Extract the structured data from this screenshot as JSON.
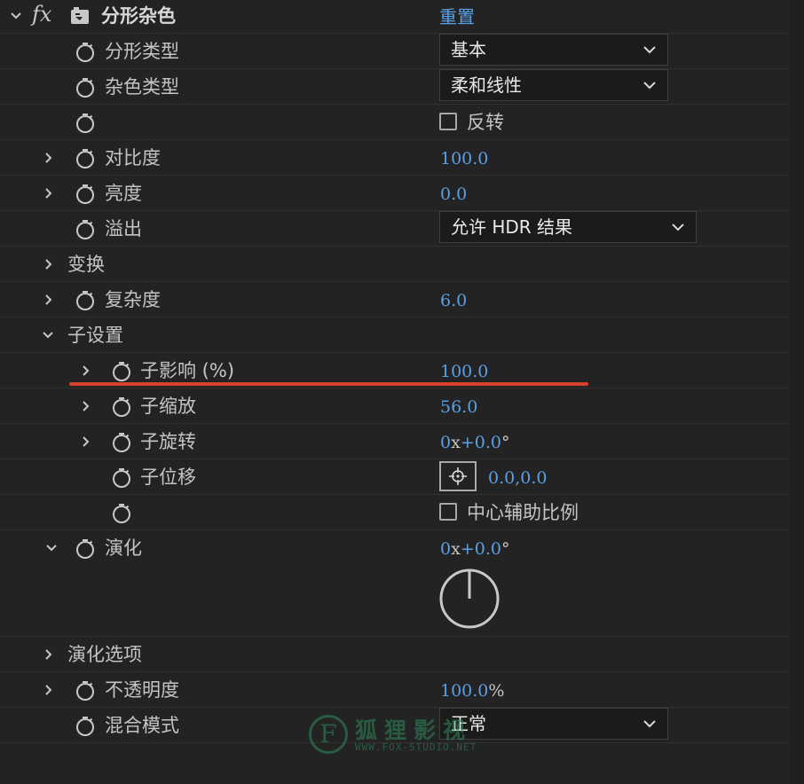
{
  "effect": {
    "name": "分形杂色",
    "reset_label": "重置",
    "fx_label": "fx"
  },
  "rows": {
    "fractal_type": {
      "label": "分形类型",
      "value": "基本"
    },
    "noise_type": {
      "label": "杂色类型",
      "value": "柔和线性"
    },
    "invert": {
      "label": "反转",
      "checked": false
    },
    "contrast": {
      "label": "对比度",
      "value": "100.0"
    },
    "brightness": {
      "label": "亮度",
      "value": "0.0"
    },
    "overflow": {
      "label": "溢出",
      "value": "允许 HDR 结果"
    },
    "transform": {
      "label": "变换"
    },
    "complexity": {
      "label": "复杂度",
      "value": "6.0"
    },
    "sub_settings": {
      "label": "子设置"
    },
    "sub_influence": {
      "label": "子影响 (%)",
      "value": "100.0"
    },
    "sub_scaling": {
      "label": "子缩放",
      "value": "56.0"
    },
    "sub_rotation": {
      "label": "子旋转",
      "revolutions": "0",
      "x_sep": "x",
      "degrees": "+0.0",
      "degree_sign": "°"
    },
    "sub_offset": {
      "label": "子位移",
      "value": "0.0,0.0"
    },
    "center_subscale": {
      "label": "中心辅助比例",
      "checked": false
    },
    "evolution": {
      "label": "演化",
      "revolutions": "0",
      "x_sep": "x",
      "degrees": "+0.0",
      "degree_sign": "°"
    },
    "evolution_options": {
      "label": "演化选项"
    },
    "opacity": {
      "label": "不透明度",
      "value": "100.0",
      "unit": "%"
    },
    "blend_mode": {
      "label": "混合模式",
      "value": "正常"
    }
  },
  "watermark": {
    "letter": "F",
    "text": "狐狸影视",
    "sub": "WWW.FOX-STUDIO.NET"
  },
  "colors": {
    "background": "#232323",
    "value_blue": "#5aa0e6",
    "highlight_red": "#d9412d"
  }
}
